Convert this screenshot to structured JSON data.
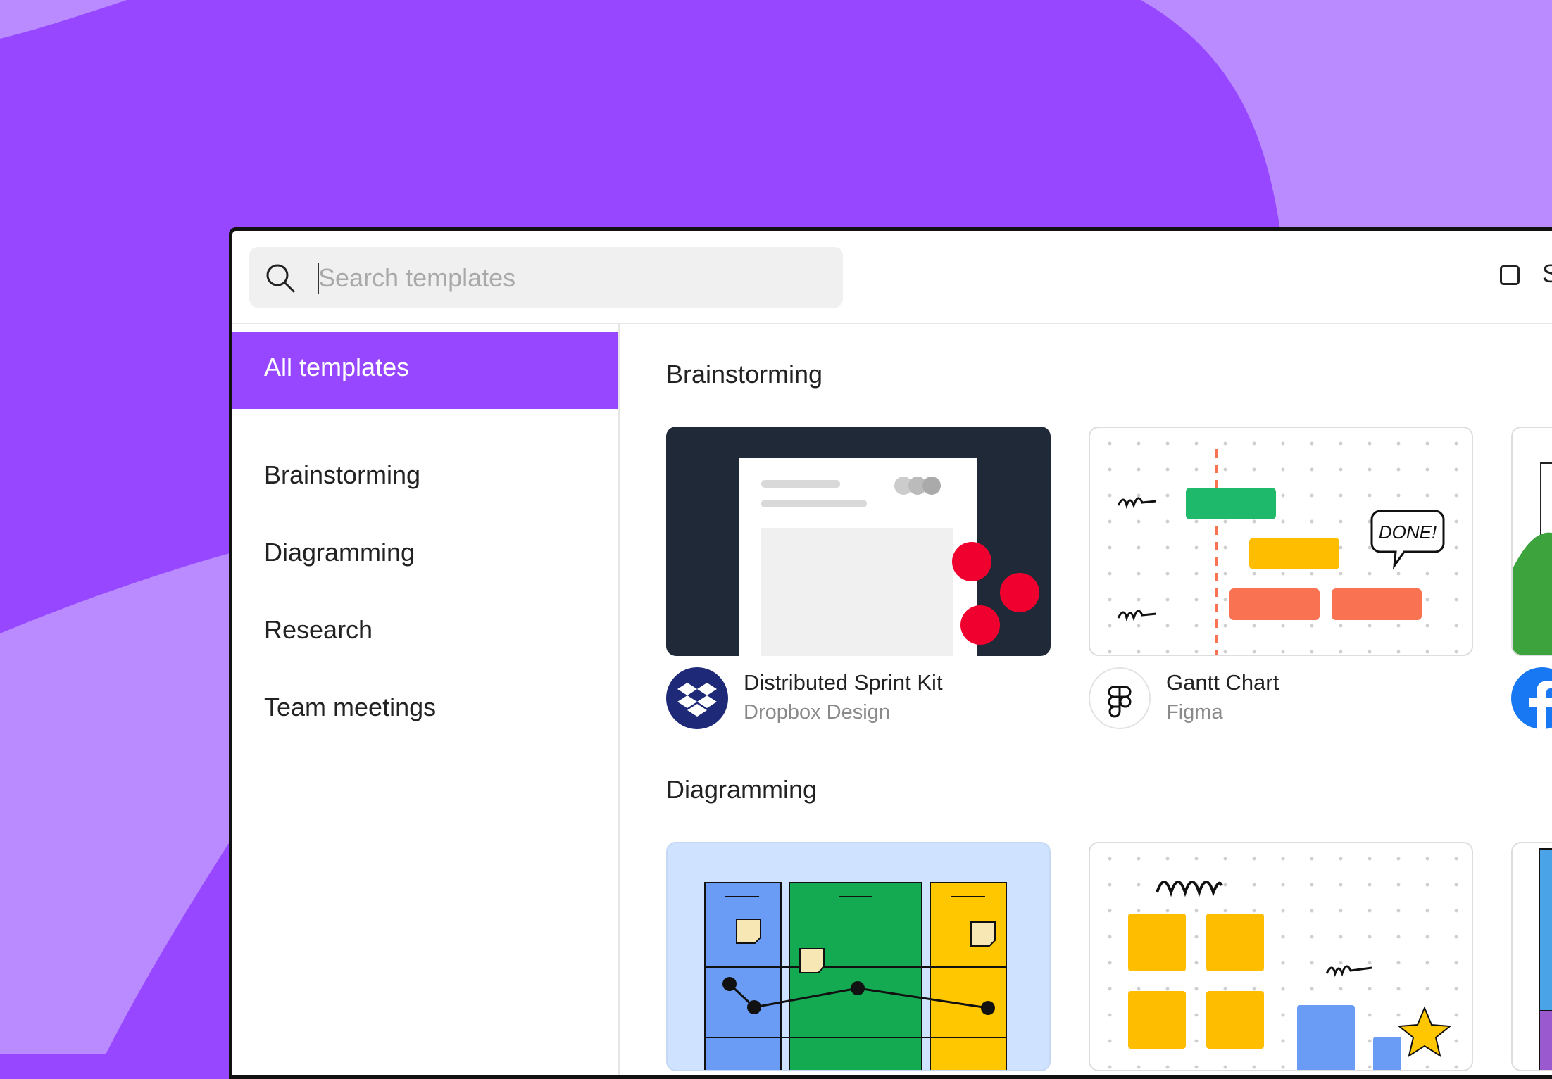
{
  "colors": {
    "accent": "#9747ff",
    "accent_light": "#b98bff",
    "text": "#222222",
    "muted": "#8a8a8a"
  },
  "search": {
    "placeholder": "Search templates",
    "icon": "search-icon"
  },
  "topbar": {
    "checkbox_label": "S"
  },
  "sidebar": {
    "items": [
      {
        "label": "All templates",
        "active": true
      },
      {
        "label": "Brainstorming",
        "active": false
      },
      {
        "label": "Diagramming",
        "active": false
      },
      {
        "label": "Research",
        "active": false
      },
      {
        "label": "Team meetings",
        "active": false
      }
    ]
  },
  "sections": [
    {
      "title": "Brainstorming",
      "cards": [
        {
          "title": "Distributed Sprint Kit",
          "author": "Dropbox Design",
          "icon": "dropbox-icon"
        },
        {
          "title": "Gantt Chart",
          "author": "Figma",
          "icon": "figma-icon",
          "callout": "DONE!"
        },
        {
          "title": "",
          "author": "",
          "icon": "facebook-icon"
        }
      ]
    },
    {
      "title": "Diagramming",
      "cards": [
        {
          "title": "",
          "author": "",
          "icon": ""
        },
        {
          "title": "",
          "author": "",
          "icon": ""
        },
        {
          "title": "",
          "author": "",
          "icon": ""
        }
      ]
    }
  ]
}
